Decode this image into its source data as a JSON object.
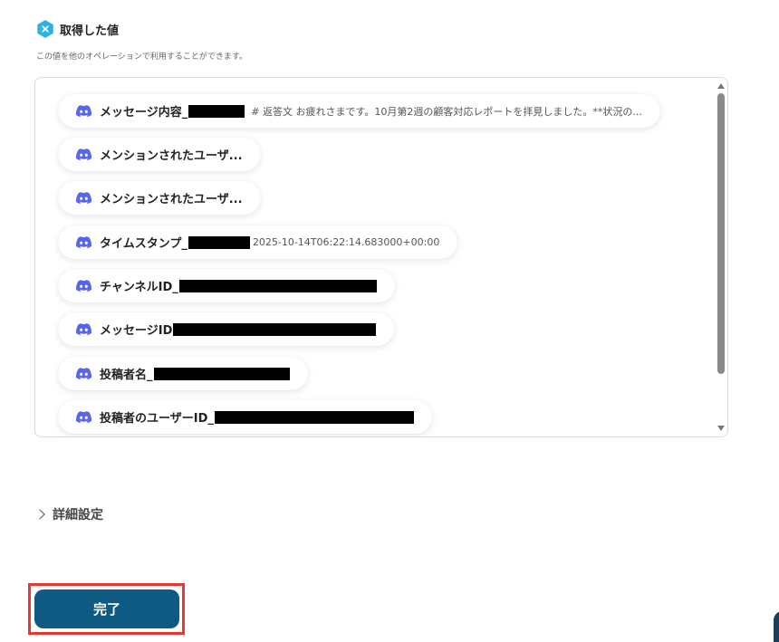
{
  "header": {
    "title": "取得した値",
    "subtitle": "この値を他のオペレーションで利用することができます。"
  },
  "items": [
    {
      "label": "メッセージ内容_",
      "value": "# 返答文 お疲れさまです。10月第2週の顧客対応レポートを拝見しました。**状況の..."
    },
    {
      "label": "メンションされたユーザ...",
      "value": ""
    },
    {
      "label": "メンションされたユーザ...",
      "value": ""
    },
    {
      "label": "タイムスタンプ_",
      "value": "2025-10-14T06:22:14.683000+00:00"
    },
    {
      "label": "チャンネルID_",
      "value": ""
    },
    {
      "label": "メッセージID",
      "value": ""
    },
    {
      "label": "投稿者名_",
      "value": ""
    },
    {
      "label": "投稿者のユーザーID_",
      "value": ""
    }
  ],
  "advanced": {
    "label": "詳細設定"
  },
  "done_button": {
    "label": "完了"
  },
  "colors": {
    "accent": "#0e5a82",
    "highlight_frame": "#e53935",
    "discord": "#5865F2",
    "header_icon": "#2bb3e6"
  }
}
